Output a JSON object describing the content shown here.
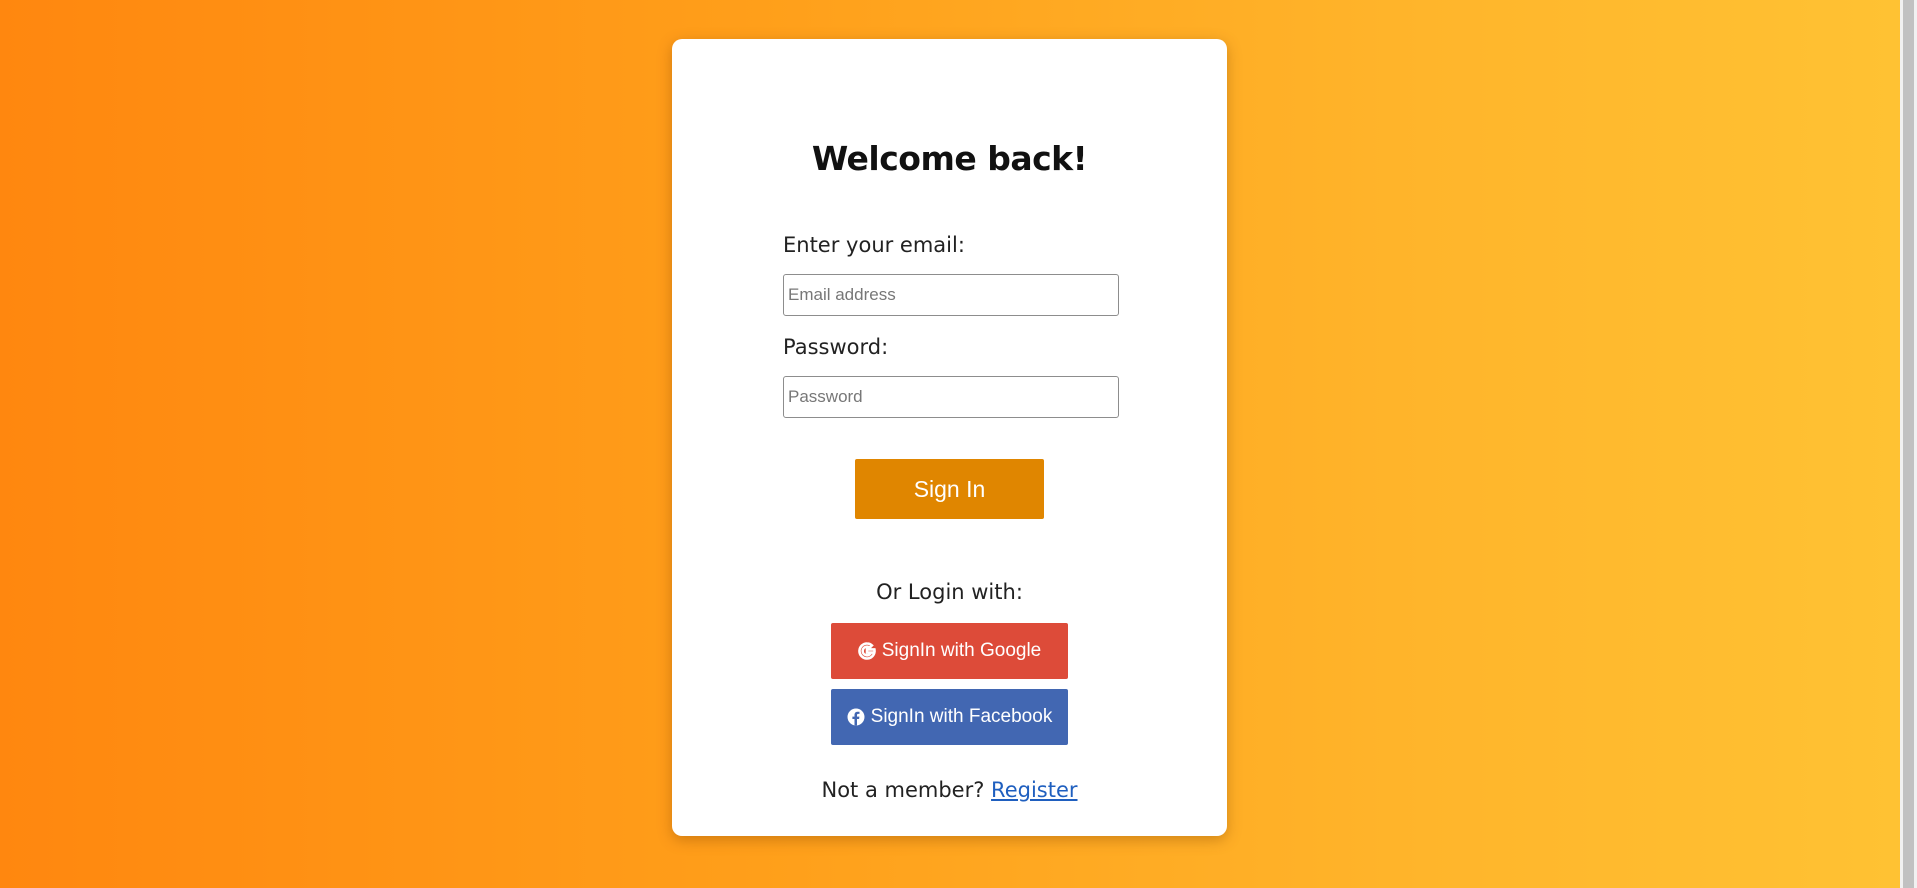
{
  "colors": {
    "gradient_start": "#ff870f",
    "gradient_end": "#ffc233",
    "card": "#ffffff",
    "signin_button": "#e08600",
    "google_button": "#dd4b39",
    "facebook_button": "#4267b2",
    "link": "#1f5fbf"
  },
  "login": {
    "title": "Welcome back!",
    "email_label": "Enter your email:",
    "email_placeholder": "Email address",
    "email_value": "",
    "password_label": "Password:",
    "password_placeholder": "Password",
    "password_value": "",
    "signin_label": "Sign In"
  },
  "social": {
    "or_text": "Or Login with:",
    "google_label": "SignIn with Google",
    "google_icon": "google-icon",
    "facebook_label": "SignIn with Facebook",
    "facebook_icon": "facebook-icon"
  },
  "footer": {
    "prompt": "Not a member?",
    "register_label": "Register"
  }
}
